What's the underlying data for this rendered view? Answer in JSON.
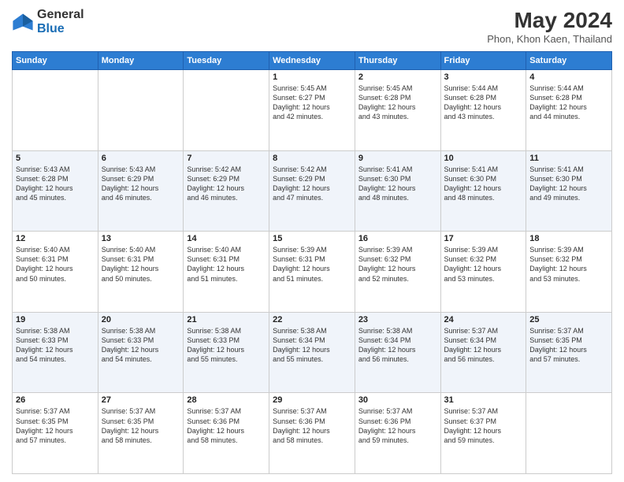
{
  "logo": {
    "general": "General",
    "blue": "Blue"
  },
  "header": {
    "month_year": "May 2024",
    "location": "Phon, Khon Kaen, Thailand"
  },
  "days_of_week": [
    "Sunday",
    "Monday",
    "Tuesday",
    "Wednesday",
    "Thursday",
    "Friday",
    "Saturday"
  ],
  "weeks": [
    [
      {
        "day": "",
        "info": ""
      },
      {
        "day": "",
        "info": ""
      },
      {
        "day": "",
        "info": ""
      },
      {
        "day": "1",
        "info": "Sunrise: 5:45 AM\nSunset: 6:27 PM\nDaylight: 12 hours\nand 42 minutes."
      },
      {
        "day": "2",
        "info": "Sunrise: 5:45 AM\nSunset: 6:28 PM\nDaylight: 12 hours\nand 43 minutes."
      },
      {
        "day": "3",
        "info": "Sunrise: 5:44 AM\nSunset: 6:28 PM\nDaylight: 12 hours\nand 43 minutes."
      },
      {
        "day": "4",
        "info": "Sunrise: 5:44 AM\nSunset: 6:28 PM\nDaylight: 12 hours\nand 44 minutes."
      }
    ],
    [
      {
        "day": "5",
        "info": "Sunrise: 5:43 AM\nSunset: 6:28 PM\nDaylight: 12 hours\nand 45 minutes."
      },
      {
        "day": "6",
        "info": "Sunrise: 5:43 AM\nSunset: 6:29 PM\nDaylight: 12 hours\nand 46 minutes."
      },
      {
        "day": "7",
        "info": "Sunrise: 5:42 AM\nSunset: 6:29 PM\nDaylight: 12 hours\nand 46 minutes."
      },
      {
        "day": "8",
        "info": "Sunrise: 5:42 AM\nSunset: 6:29 PM\nDaylight: 12 hours\nand 47 minutes."
      },
      {
        "day": "9",
        "info": "Sunrise: 5:41 AM\nSunset: 6:30 PM\nDaylight: 12 hours\nand 48 minutes."
      },
      {
        "day": "10",
        "info": "Sunrise: 5:41 AM\nSunset: 6:30 PM\nDaylight: 12 hours\nand 48 minutes."
      },
      {
        "day": "11",
        "info": "Sunrise: 5:41 AM\nSunset: 6:30 PM\nDaylight: 12 hours\nand 49 minutes."
      }
    ],
    [
      {
        "day": "12",
        "info": "Sunrise: 5:40 AM\nSunset: 6:31 PM\nDaylight: 12 hours\nand 50 minutes."
      },
      {
        "day": "13",
        "info": "Sunrise: 5:40 AM\nSunset: 6:31 PM\nDaylight: 12 hours\nand 50 minutes."
      },
      {
        "day": "14",
        "info": "Sunrise: 5:40 AM\nSunset: 6:31 PM\nDaylight: 12 hours\nand 51 minutes."
      },
      {
        "day": "15",
        "info": "Sunrise: 5:39 AM\nSunset: 6:31 PM\nDaylight: 12 hours\nand 51 minutes."
      },
      {
        "day": "16",
        "info": "Sunrise: 5:39 AM\nSunset: 6:32 PM\nDaylight: 12 hours\nand 52 minutes."
      },
      {
        "day": "17",
        "info": "Sunrise: 5:39 AM\nSunset: 6:32 PM\nDaylight: 12 hours\nand 53 minutes."
      },
      {
        "day": "18",
        "info": "Sunrise: 5:39 AM\nSunset: 6:32 PM\nDaylight: 12 hours\nand 53 minutes."
      }
    ],
    [
      {
        "day": "19",
        "info": "Sunrise: 5:38 AM\nSunset: 6:33 PM\nDaylight: 12 hours\nand 54 minutes."
      },
      {
        "day": "20",
        "info": "Sunrise: 5:38 AM\nSunset: 6:33 PM\nDaylight: 12 hours\nand 54 minutes."
      },
      {
        "day": "21",
        "info": "Sunrise: 5:38 AM\nSunset: 6:33 PM\nDaylight: 12 hours\nand 55 minutes."
      },
      {
        "day": "22",
        "info": "Sunrise: 5:38 AM\nSunset: 6:34 PM\nDaylight: 12 hours\nand 55 minutes."
      },
      {
        "day": "23",
        "info": "Sunrise: 5:38 AM\nSunset: 6:34 PM\nDaylight: 12 hours\nand 56 minutes."
      },
      {
        "day": "24",
        "info": "Sunrise: 5:37 AM\nSunset: 6:34 PM\nDaylight: 12 hours\nand 56 minutes."
      },
      {
        "day": "25",
        "info": "Sunrise: 5:37 AM\nSunset: 6:35 PM\nDaylight: 12 hours\nand 57 minutes."
      }
    ],
    [
      {
        "day": "26",
        "info": "Sunrise: 5:37 AM\nSunset: 6:35 PM\nDaylight: 12 hours\nand 57 minutes."
      },
      {
        "day": "27",
        "info": "Sunrise: 5:37 AM\nSunset: 6:35 PM\nDaylight: 12 hours\nand 58 minutes."
      },
      {
        "day": "28",
        "info": "Sunrise: 5:37 AM\nSunset: 6:36 PM\nDaylight: 12 hours\nand 58 minutes."
      },
      {
        "day": "29",
        "info": "Sunrise: 5:37 AM\nSunset: 6:36 PM\nDaylight: 12 hours\nand 58 minutes."
      },
      {
        "day": "30",
        "info": "Sunrise: 5:37 AM\nSunset: 6:36 PM\nDaylight: 12 hours\nand 59 minutes."
      },
      {
        "day": "31",
        "info": "Sunrise: 5:37 AM\nSunset: 6:37 PM\nDaylight: 12 hours\nand 59 minutes."
      },
      {
        "day": "",
        "info": ""
      }
    ]
  ]
}
